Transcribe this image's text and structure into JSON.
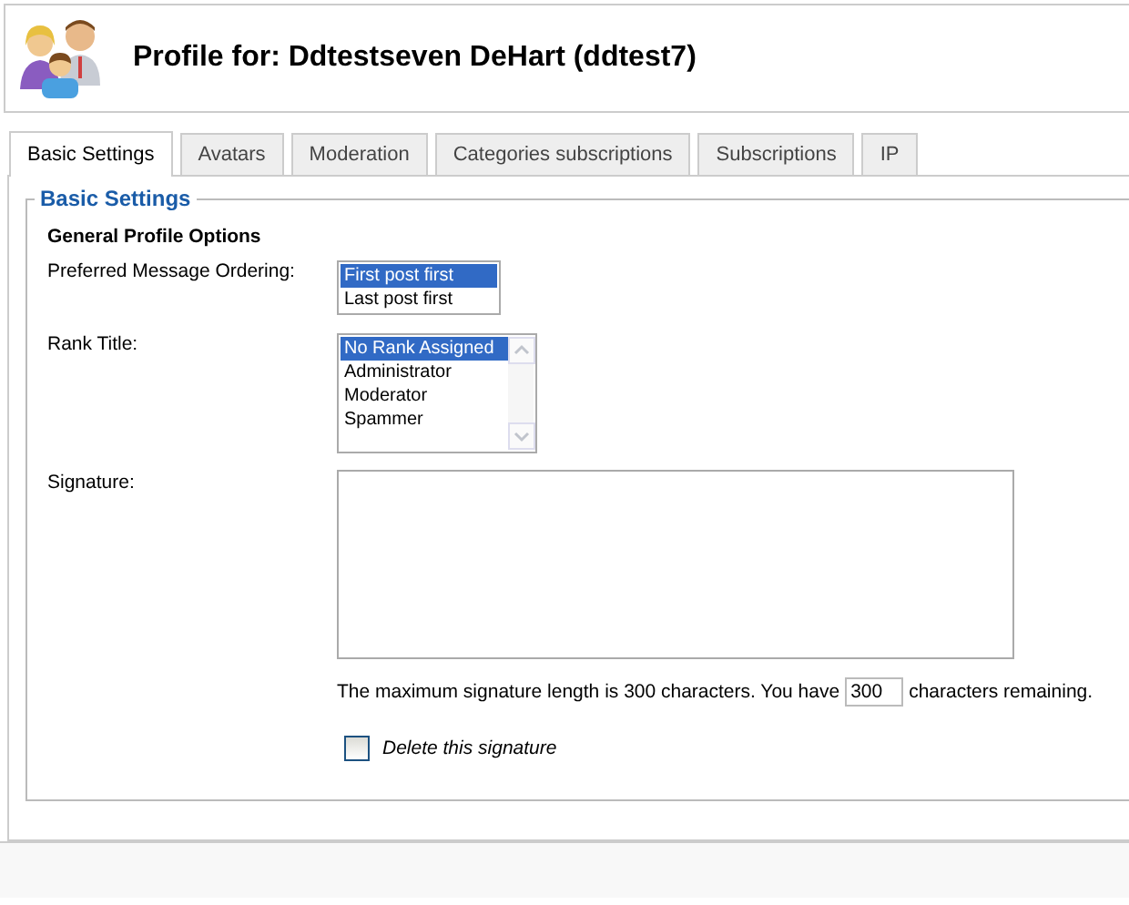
{
  "header": {
    "title": "Profile for: Ddtestseven DeHart (ddtest7)"
  },
  "tabs": [
    {
      "label": "Basic Settings",
      "selected": true
    },
    {
      "label": "Avatars",
      "selected": false
    },
    {
      "label": "Moderation",
      "selected": false
    },
    {
      "label": "Categories subscriptions",
      "selected": false
    },
    {
      "label": "Subscriptions",
      "selected": false
    },
    {
      "label": "IP",
      "selected": false
    }
  ],
  "fieldset": {
    "legend": "Basic Settings",
    "section_title": "General Profile Options",
    "ordering": {
      "label": "Preferred Message Ordering:",
      "options": [
        {
          "label": "First post first",
          "selected": true
        },
        {
          "label": "Last post first",
          "selected": false
        }
      ]
    },
    "rank": {
      "label": "Rank Title:",
      "options": [
        {
          "label": "No Rank Assigned",
          "selected": true
        },
        {
          "label": "Administrator",
          "selected": false
        },
        {
          "label": "Moderator",
          "selected": false
        },
        {
          "label": "Spammer",
          "selected": false
        }
      ]
    },
    "signature": {
      "label": "Signature:"
    },
    "length_text_before": "The maximum signature length is 300 characters. You have",
    "remaining": "300",
    "length_text_after": "characters remaining.",
    "delete": {
      "label": "Delete this signature",
      "checked": false
    }
  }
}
